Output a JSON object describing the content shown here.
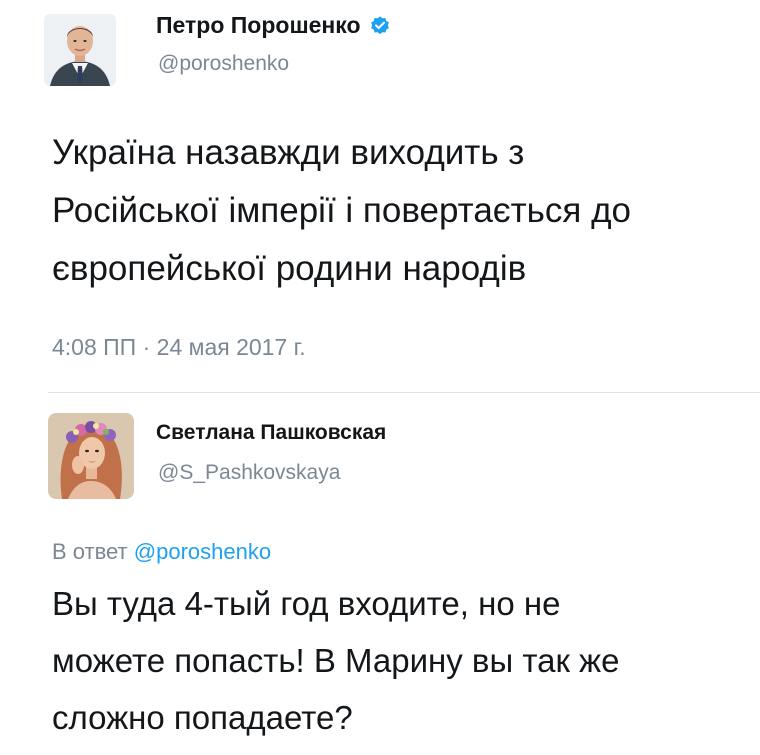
{
  "tweet": {
    "author": {
      "display_name": "Петро Порошенко",
      "handle": "@poroshenko",
      "verified": true,
      "avatar_icon": "portrait-avatar-man"
    },
    "text": "Україна назавжди виходить з\nРосійської імперії і повертається до\nєвропейської родини народів",
    "timestamp": "4:08 ПП · 24 мая 2017 г."
  },
  "reply": {
    "author": {
      "display_name": "Светлана Пашковская",
      "handle": "@S_Pashkovskaya",
      "avatar_icon": "portrait-avatar-woman-flower-wreath"
    },
    "reply_prefix": "В ответ",
    "reply_to": "@poroshenko",
    "text": "Вы туда 4-тый год входите, но не\nможете попасть! В Марину вы так же\nсложно попадаете?"
  },
  "colors": {
    "link": "#1da1f2",
    "muted": "#7b8894",
    "text": "#14171a",
    "verified_badge": "#1da1f2"
  }
}
